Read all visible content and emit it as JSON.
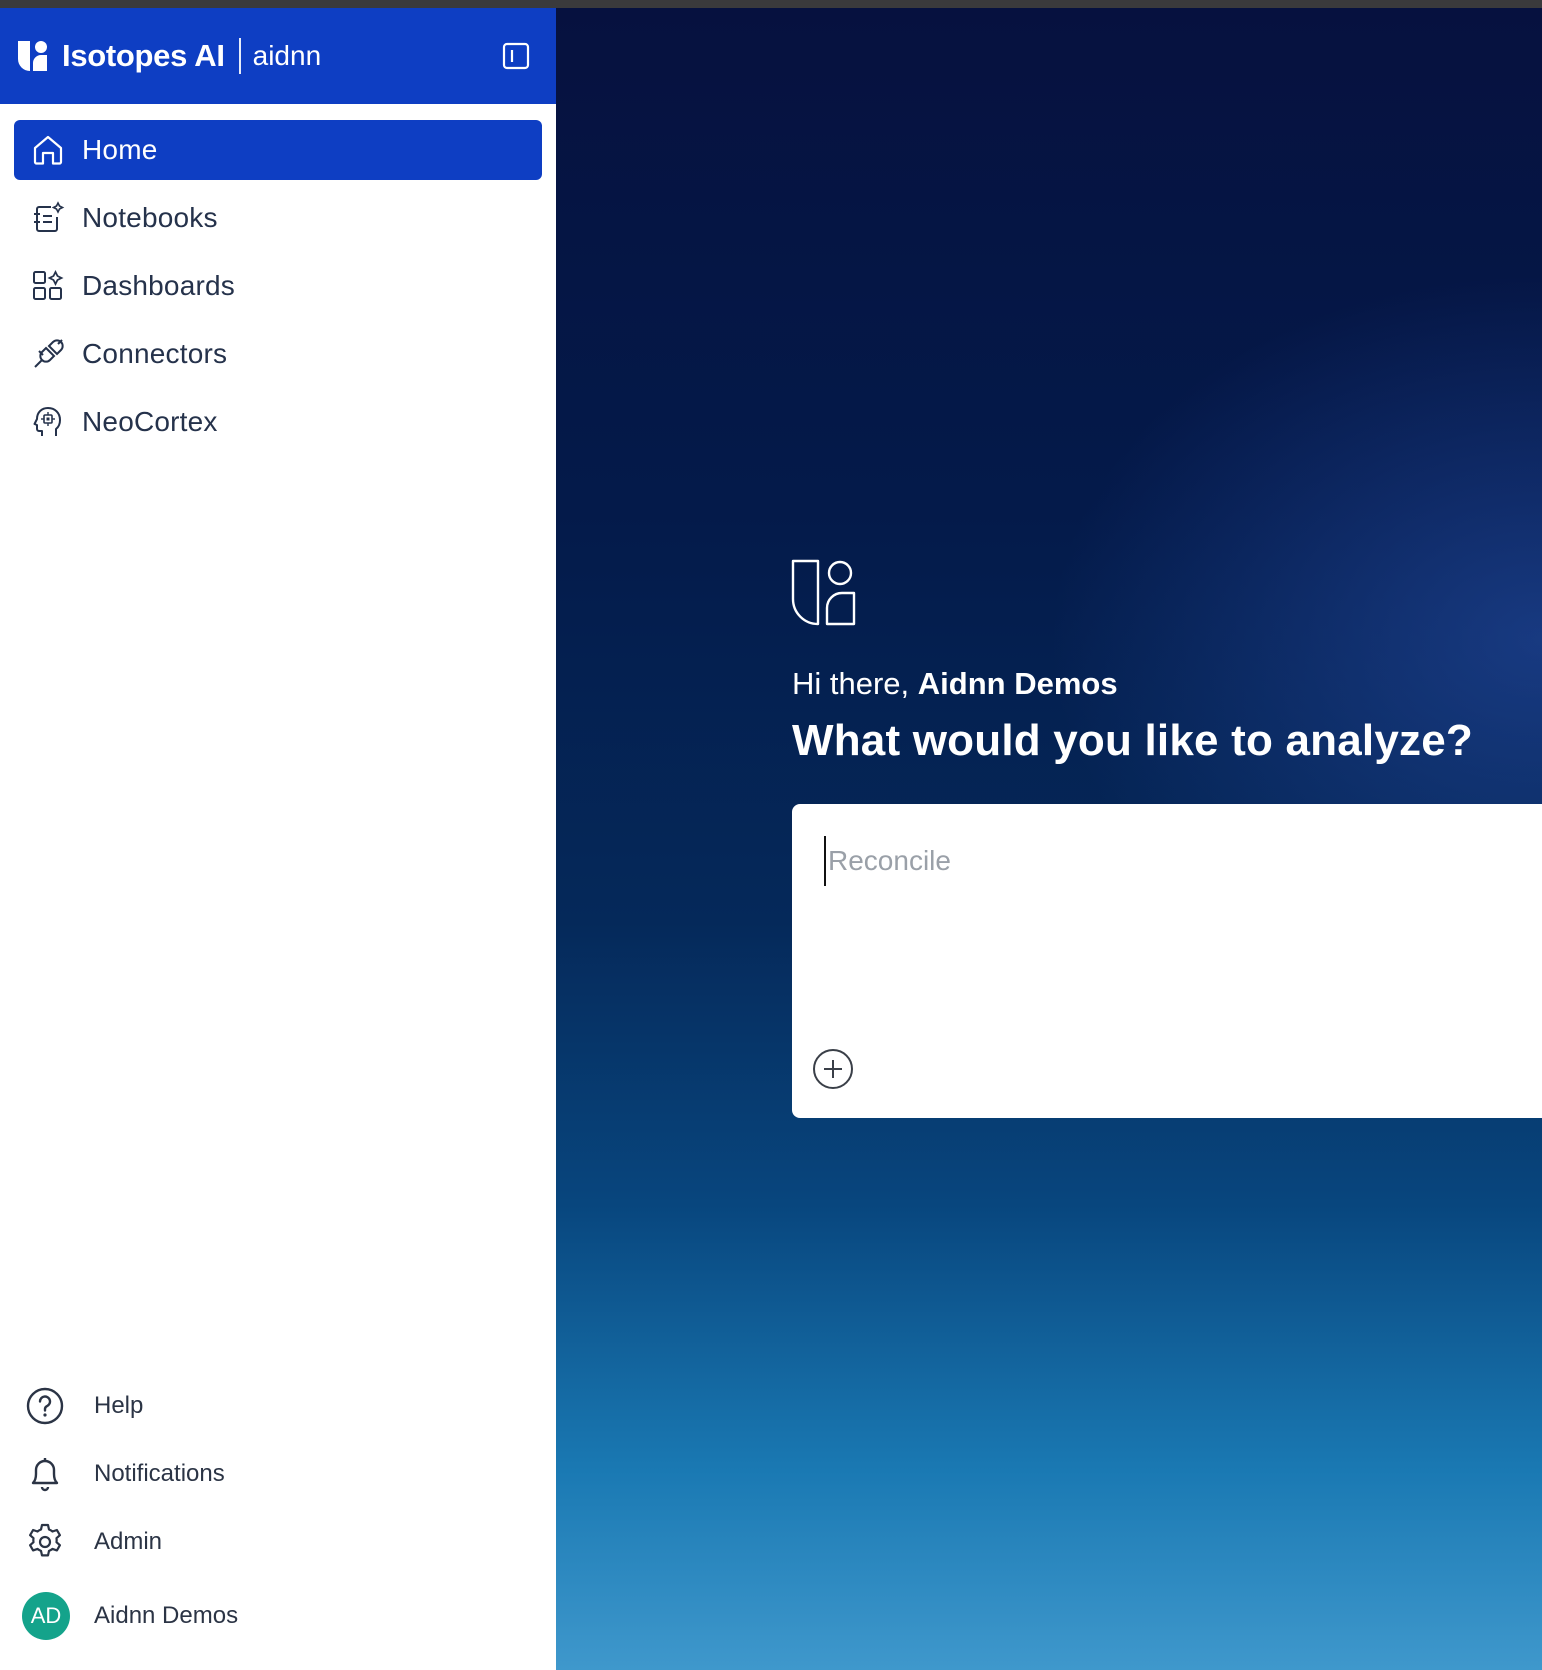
{
  "sidebar": {
    "brand": {
      "name": "Isotopes AI",
      "org": "aidnn"
    },
    "nav": [
      {
        "label": "Home",
        "icon": "home-icon",
        "active": true
      },
      {
        "label": "Notebooks",
        "icon": "notebook-icon",
        "active": false
      },
      {
        "label": "Dashboards",
        "icon": "dashboard-icon",
        "active": false
      },
      {
        "label": "Connectors",
        "icon": "plug-icon",
        "active": false
      },
      {
        "label": "NeoCortex",
        "icon": "brain-head-icon",
        "active": false
      }
    ],
    "bottom": [
      {
        "label": "Help",
        "icon": "help-circle-icon"
      },
      {
        "label": "Notifications",
        "icon": "bell-icon"
      },
      {
        "label": "Admin",
        "icon": "gear-icon"
      }
    ],
    "user": {
      "initials": "AD",
      "name": "Aidnn Demos"
    }
  },
  "main": {
    "greeting_prefix": "Hi there, ",
    "greeting_name": "Aidnn Demos",
    "headline": "What would you like to analyze?",
    "prompt": {
      "placeholder": "Reconcile",
      "value": ""
    }
  },
  "colors": {
    "brand_blue": "#0e3ec3",
    "avatar_teal": "#14a38b",
    "nav_text": "#25324b"
  }
}
